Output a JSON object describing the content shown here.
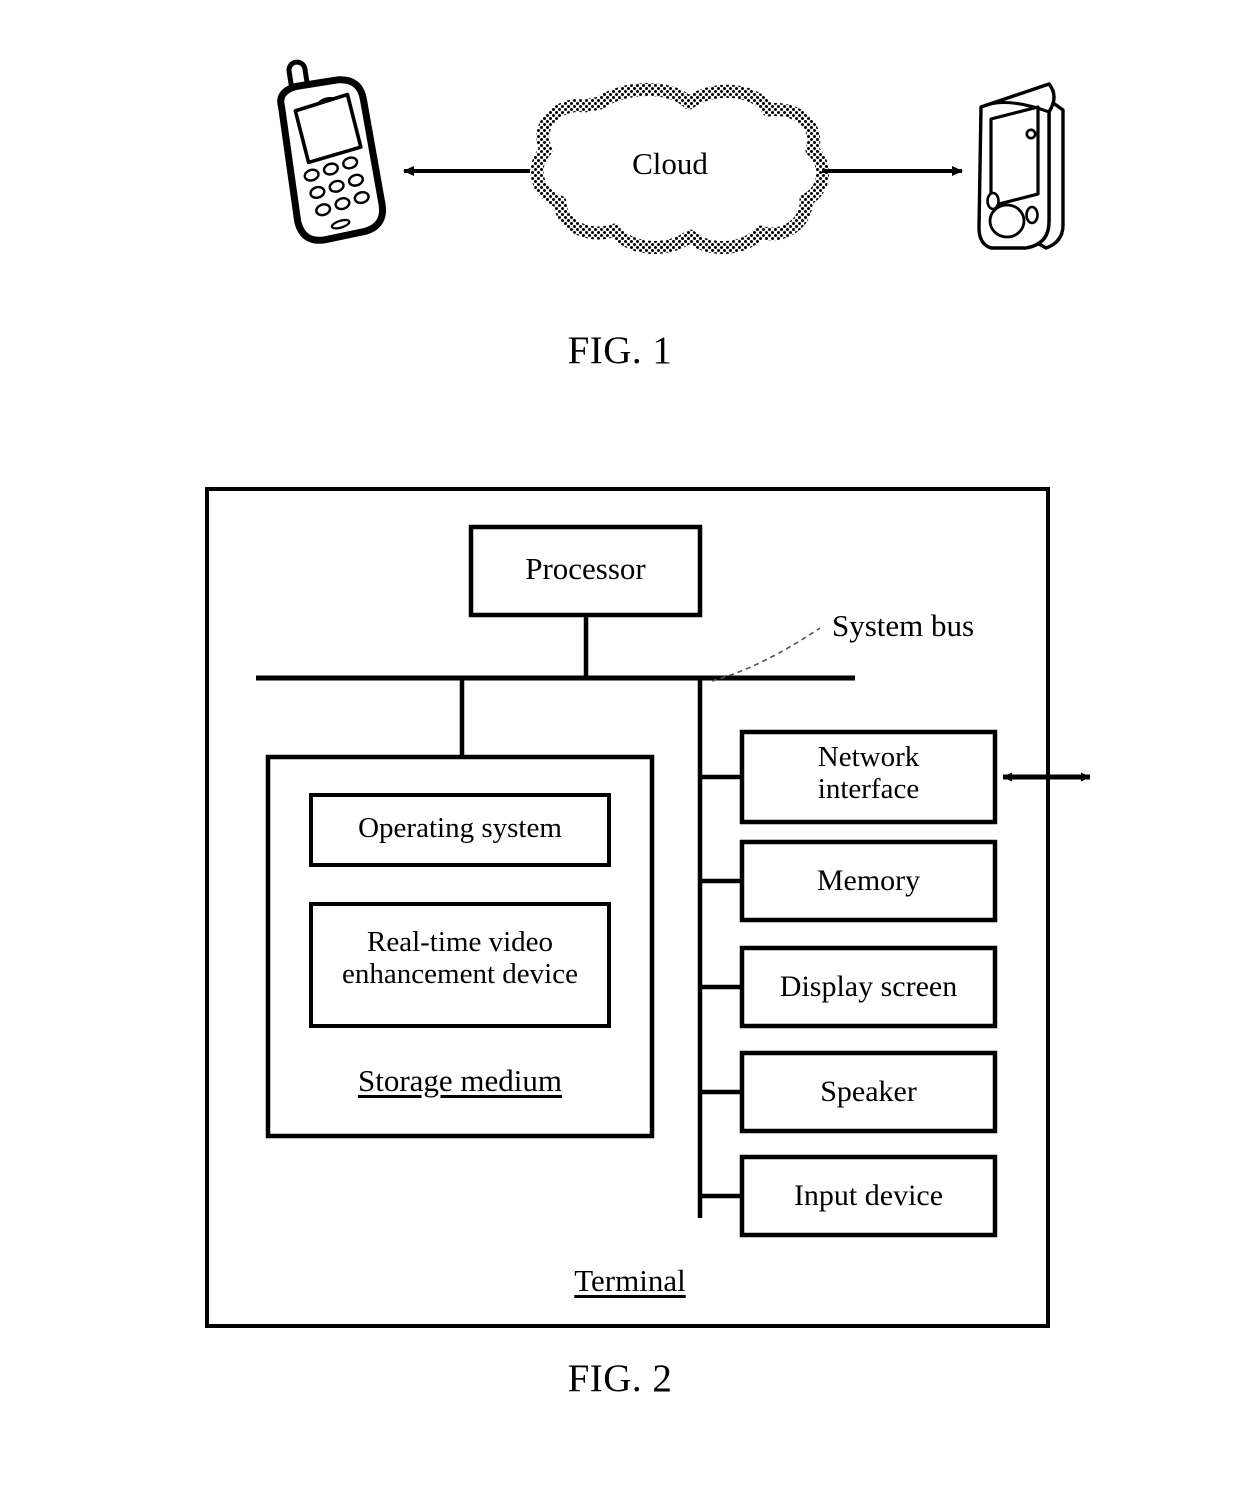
{
  "figures": [
    {
      "id": "fig1",
      "caption": "FIG. 1",
      "nodes": {
        "left_device": "mobile-phone",
        "cloud_label": "Cloud",
        "right_device": "pda-device"
      }
    },
    {
      "id": "fig2",
      "caption": "FIG. 2",
      "outer_box_label": "Terminal",
      "processor_label": "Processor",
      "system_bus_label": "System bus",
      "storage": {
        "title": "Storage medium",
        "items": [
          "Operating system",
          "Real-time video\nenhancement device"
        ],
        "item_1_line_1": "Real-time video",
        "item_1_line_2": "enhancement device"
      },
      "peripherals": [
        {
          "label": "Network interface",
          "line_1": "Network",
          "line_2": "interface"
        },
        {
          "label": "Memory"
        },
        {
          "label": "Display screen"
        },
        {
          "label": "Speaker"
        },
        {
          "label": "Input device"
        }
      ]
    }
  ],
  "fig1": {
    "caption": "FIG. 1",
    "cloud_label": "Cloud"
  },
  "fig2": {
    "caption": "FIG. 2",
    "terminal_label": "Terminal",
    "processor_label": "Processor",
    "system_bus_label": "System bus",
    "storage_medium_label": "Storage medium",
    "operating_system_label": "Operating system",
    "rtv_line1": "Real-time video",
    "rtv_line2": "enhancement device",
    "network_interface_line1": "Network",
    "network_interface_line2": "interface",
    "memory_label": "Memory",
    "display_screen_label": "Display screen",
    "speaker_label": "Speaker",
    "input_device_label": "Input device"
  },
  "colors": {
    "stroke": "#000000",
    "background": "#ffffff"
  }
}
